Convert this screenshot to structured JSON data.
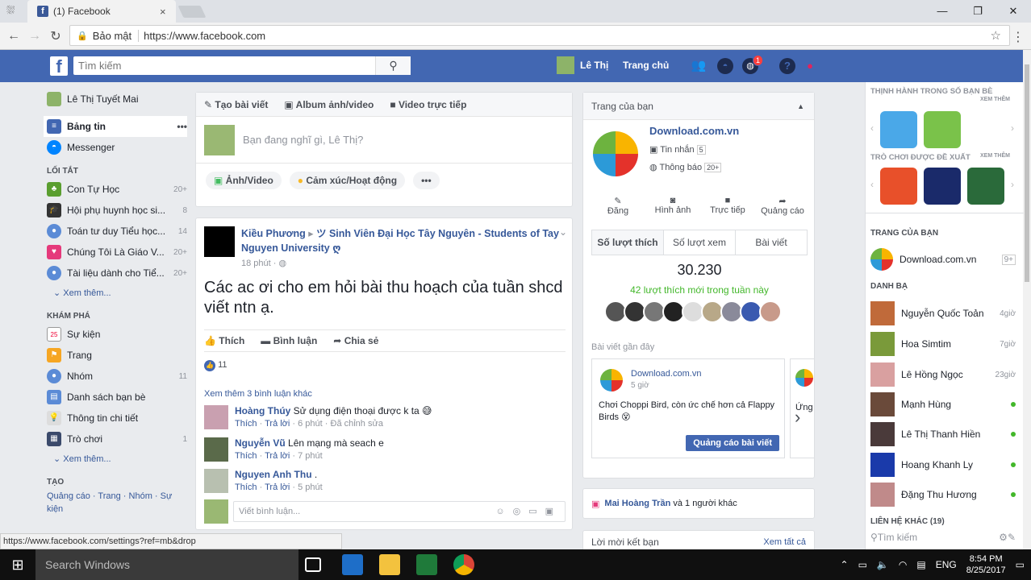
{
  "browser": {
    "tab_title": "(1) Facebook",
    "tab_close": "×",
    "win_min": "—",
    "win_restore": "❐",
    "win_close": "✕",
    "security_label": "Bảo mật",
    "url": "https://www.facebook.com",
    "status_url": "https://www.facebook.com/settings?ref=mb&drop"
  },
  "topbar": {
    "logo": "f",
    "search_placeholder": "Tìm kiếm",
    "user_name": "Lê Thị",
    "home_label": "Trang chủ",
    "notif_count": "1",
    "brand_color": "#4267b2"
  },
  "leftnav": {
    "profile": "Lê Thị Tuyết Mai",
    "news_feed": "Bảng tin",
    "news_feed_more": "•••",
    "messenger": "Messenger",
    "shortcuts_header": "LỐI TẮT",
    "shortcuts": [
      {
        "label": "Con Tự Học",
        "count": "20+",
        "color": "#5a9e2f"
      },
      {
        "label": "Hội phụ huynh học si...",
        "count": "8",
        "color": "#333"
      },
      {
        "label": "Toán tư duy Tiểu học...",
        "count": "14",
        "color": "#5b8bd6"
      },
      {
        "label": "Chúng Tôi Là Giáo V...",
        "count": "20+",
        "color": "#e5397b"
      },
      {
        "label": "Tài liệu dành cho Tiể...",
        "count": "20+",
        "color": "#5b8bd6"
      }
    ],
    "see_more": "Xem thêm...",
    "explore_header": "KHÁM PHÁ",
    "explore": [
      {
        "label": "Sự kiện",
        "count": "",
        "icon": "25"
      },
      {
        "label": "Trang",
        "count": ""
      },
      {
        "label": "Nhóm",
        "count": "11"
      },
      {
        "label": "Danh sách bạn bè",
        "count": ""
      },
      {
        "label": "Thông tin chi tiết",
        "count": ""
      },
      {
        "label": "Trò chơi",
        "count": "1"
      }
    ],
    "see_more2": "Xem thêm...",
    "create_header": "TẠO",
    "create_links": [
      "Quảng cáo",
      "Trang",
      "Nhóm",
      "Sự kiện"
    ]
  },
  "composer": {
    "tab_post": "Tạo bài viết",
    "tab_album": "Album ảnh/video",
    "tab_live": "Video trực tiếp",
    "placeholder": "Bạn đang nghĩ gì, Lê Thị?",
    "btn_photo": "Ảnh/Video",
    "btn_feeling": "Cảm xúc/Hoạt động",
    "btn_more": "•••"
  },
  "post": {
    "author": "Kiều Phương",
    "group": "ツ Sinh Viên Đại Học Tây Nguyên - Students of Tay Nguyen University ღ",
    "time": "18 phút",
    "body": "Các ac ơi cho em hỏi bài thu hoạch của tuần shcd viết ntn ạ.",
    "like": "Thích",
    "comment": "Bình luận",
    "share": "Chia sẻ",
    "likes_count": "11",
    "more_comments": "Xem thêm 3 bình luận khác",
    "comments": [
      {
        "name": "Hoàng Thúy",
        "text": "Sử dụng điện thoại được k ta 😅",
        "like": "Thích",
        "reply": "Trả lời",
        "time": "6 phút",
        "edited": "Đã chỉnh sửa"
      },
      {
        "name": "Nguyễn Vũ",
        "text": "Lên mạng mà seach e",
        "like": "Thích",
        "reply": "Trả lời",
        "time": "7 phút",
        "edited": ""
      },
      {
        "name": "Nguyen Anh Thu",
        "text": ".",
        "like": "Thích",
        "reply": "Trả lời",
        "time": "5 phút",
        "edited": ""
      }
    ],
    "write_comment": "Viết bình luận..."
  },
  "pagecard": {
    "header": "Trang của bạn",
    "page_name": "Download.com.vn",
    "messages_label": "Tin nhắn",
    "messages_count": "5",
    "notif_label": "Thông báo",
    "notif_count": "20+",
    "actions": [
      "Đăng",
      "Hình ảnh",
      "Trực tiếp",
      "Quảng cáo"
    ],
    "tabs": [
      "Số lượt thích",
      "Số lượt xem",
      "Bài viết"
    ],
    "likes_total": "30.230",
    "likes_new": "42 lượt thích mới trong tuần này",
    "recent_header": "Bài viết gần đây",
    "recent_post": {
      "name": "Download.com.vn",
      "time": "5 giờ",
      "text": "Chơi Choppi Bird, còn ức chế hơn cả Flappy Birds 😵",
      "ad_button": "Quảng cáo bài viết"
    },
    "peek_text": "Ứng"
  },
  "mai": {
    "name": "Mai Hoàng Trần",
    "rest": "và 1 người khác"
  },
  "friend_requests": {
    "title": "Lời mời kết bạn",
    "see_all": "Xem tất cả"
  },
  "chat": {
    "trending_header": "THỊNH HÀNH TRONG SỐ BẠN BÈ",
    "see_more": "XEM THÊM",
    "suggested_header": "TRÒ CHƠI ĐƯỢC ĐỀ XUẤT",
    "pages_header": "TRANG CỦA BẠN",
    "page_name": "Download.com.vn",
    "page_badge": "9+",
    "contacts_header": "DANH BẠ",
    "contacts": [
      {
        "name": "Nguyễn Quốc Toản",
        "status": "4giờ",
        "color": "#c06a3a"
      },
      {
        "name": "Hoa Simtim",
        "status": "7giờ",
        "color": "#7a9a3a"
      },
      {
        "name": "Lê Hồng Ngọc",
        "status": "23giờ",
        "color": "#d9a0a0"
      },
      {
        "name": "Mạnh Hùng",
        "status": "",
        "color": "#6a4a3a"
      },
      {
        "name": "Lê Thị Thanh Hiền",
        "status": "",
        "color": "#4a3a3a"
      },
      {
        "name": "Hoang Khanh Ly",
        "status": "",
        "color": "#1a3aaa"
      },
      {
        "name": "Đặng Thu Hương",
        "status": "",
        "color": "#c08a8a"
      }
    ],
    "other_contacts": "LIÊN HỆ KHÁC (19)",
    "search_placeholder": "Tìm kiếm"
  },
  "taskbar": {
    "search": "Search Windows",
    "lang": "ENG",
    "time": "8:54 PM",
    "date": "8/25/2017"
  }
}
